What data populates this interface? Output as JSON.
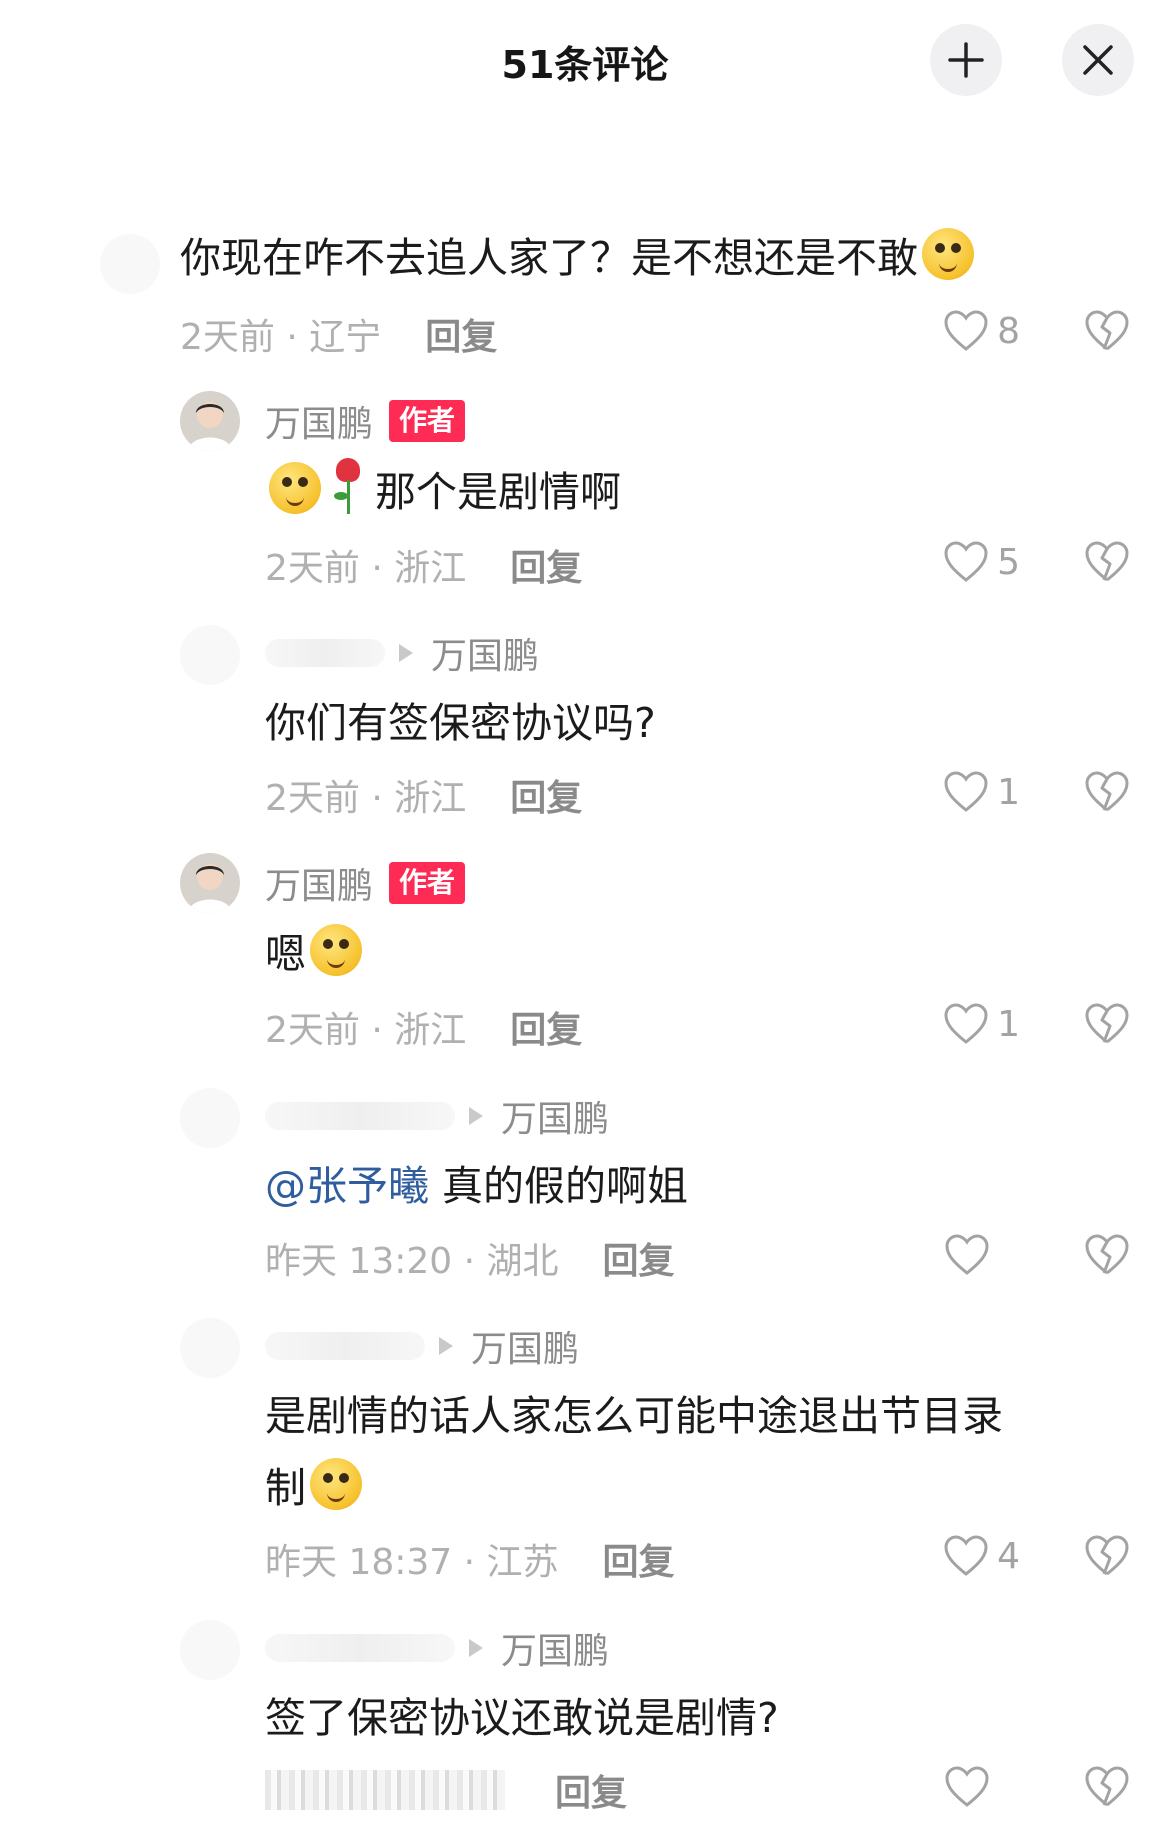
{
  "header": {
    "title": "51条评论",
    "collapse_icon": "collapse-icon",
    "close_icon": "close-icon"
  },
  "comments": [
    {
      "text": "你现在咋不去追人家了？是不想还是不敢",
      "time_loc": "2天前 · 辽宁",
      "reply": "回复",
      "likes": "8"
    },
    {
      "name": "万国鹏",
      "badge": "作者",
      "text": "那个是剧情啊",
      "time_loc": "2天前 · 浙江",
      "reply": "回复",
      "likes": "5"
    },
    {
      "reply_to": "万国鹏",
      "text": "你们有签保密协议吗?",
      "time_loc": "2天前 · 浙江",
      "reply": "回复",
      "likes": "1"
    },
    {
      "name": "万国鹏",
      "badge": "作者",
      "text": "嗯",
      "time_loc": "2天前 · 浙江",
      "reply": "回复",
      "likes": "1"
    },
    {
      "reply_to": "万国鹏",
      "mention": "@张予曦",
      "text": " 真的假的啊姐",
      "time_loc": "昨天 13:20 · 湖北",
      "reply": "回复",
      "likes": ""
    },
    {
      "reply_to": "万国鹏",
      "text_line1": "是剧情的话人家怎么可能中途退出节目录",
      "text_line2": "制",
      "time_loc": "昨天 18:37 · 江苏",
      "reply": "回复",
      "likes": "4"
    },
    {
      "reply_to": "万国鹏",
      "text": "签了保密协议还敢说是剧情?",
      "reply": "回复",
      "likes": ""
    }
  ],
  "icons": {
    "like": "heart-outline-icon",
    "dislike": "broken-heart-icon"
  }
}
